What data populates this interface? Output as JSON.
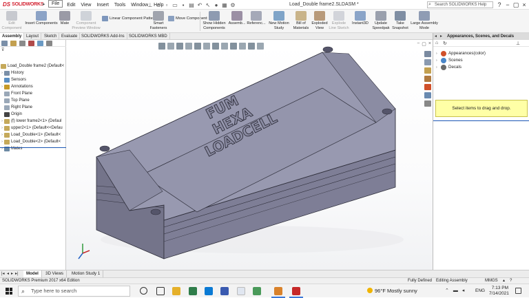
{
  "app": {
    "brand_ds": "DS",
    "brand_name": "SOLIDWORKS"
  },
  "menu": [
    "File",
    "Edit",
    "View",
    "Insert",
    "Tools",
    "Window",
    "Help"
  ],
  "window": {
    "title": "Load_Double frame2.SLDASM *",
    "help_search_placeholder": "Search SOLIDWORKS Help"
  },
  "ribbon": {
    "edit_component": "Edit\nComponent",
    "insert_components": "Insert Components",
    "mate": "Mate",
    "component_preview": "Component\nPreview Window",
    "linear_pattern": "Linear Component Pattern",
    "smart_fasteners": "Smart\nFasteners",
    "move_component": "Move Component",
    "show_hidden": "Show Hidden\nComponents",
    "assembly_features": "Assemb...",
    "reference_geometry": "Referenc...",
    "new_motion_study": "New Motion\nStudy",
    "bill_of_materials": "Bill of\nMaterials",
    "exploded_view": "Exploded\nView",
    "explode_line": "Explode\nLine Sketch",
    "instant3d": "Instant3D",
    "update_speedpak": "Update\nSpeedpak",
    "take_snapshot": "Take\nSnapshot",
    "large_assembly": "Large Assembly\nMode"
  },
  "command_tabs": [
    "Assembly",
    "Layout",
    "Sketch",
    "Evaluate",
    "SOLIDWORKS Add-Ins",
    "SOLIDWORKS MBD"
  ],
  "tree": {
    "root": "Load_Double frame2  (Default<",
    "items": [
      {
        "label": "History",
        "arrow": "›",
        "color": "#7a8fa8"
      },
      {
        "label": "Sensors",
        "arrow": "",
        "color": "#5a8fc4"
      },
      {
        "label": "Annotations",
        "arrow": "›",
        "color": "#c59a2a"
      },
      {
        "label": "Front Plane",
        "arrow": "",
        "color": "#9aa8b8"
      },
      {
        "label": "Top Plane",
        "arrow": "",
        "color": "#9aa8b8"
      },
      {
        "label": "Right Plane",
        "arrow": "",
        "color": "#9aa8b8"
      },
      {
        "label": "Origin",
        "arrow": "",
        "color": "#444"
      },
      {
        "label": "(f) lower frame2<1> (Defaul",
        "arrow": "›",
        "color": "#c5a95a"
      },
      {
        "label": "upper2<1> (Default<<Defau",
        "arrow": "›",
        "color": "#c5a95a"
      },
      {
        "label": "Load_Double<1> (Default<",
        "arrow": "›",
        "color": "#c5a95a"
      },
      {
        "label": "Load_Double<2> (Default<",
        "arrow": "›",
        "color": "#c5a95a"
      },
      {
        "label": "Mates",
        "arrow": "›",
        "color": "#6c8aa4"
      }
    ]
  },
  "model": {
    "text_line1": "FUM",
    "text_line2": "HEXA",
    "text_line3": "LOADCELL",
    "body_color": "#8c8ca4",
    "top_color": "#9899b0",
    "edge_color": "#2e2e3a"
  },
  "right_panel": {
    "title": "Appearances, Scenes, and Decals",
    "items": [
      {
        "label": "Appearances(color)",
        "color": "#d0502a"
      },
      {
        "label": "Scenes",
        "color": "#4a86c8"
      },
      {
        "label": "Decals",
        "color": "#6a6a6a"
      }
    ],
    "drag_hint": "Select items to drag and drop."
  },
  "bottom_tabs": [
    "Model",
    "3D Views",
    "Motion Study 1"
  ],
  "status": {
    "edition": "SOLIDWORKS Premium 2017 x64 Edition",
    "state": "Fully Defined",
    "mode": "Editing Assembly",
    "units": "MMGS"
  },
  "taskbar": {
    "search_placeholder": "Type here to search",
    "weather": "96°F  Mostly sunny",
    "language": "ENG",
    "time": "7:13 PM",
    "date": "7/14/2021"
  }
}
